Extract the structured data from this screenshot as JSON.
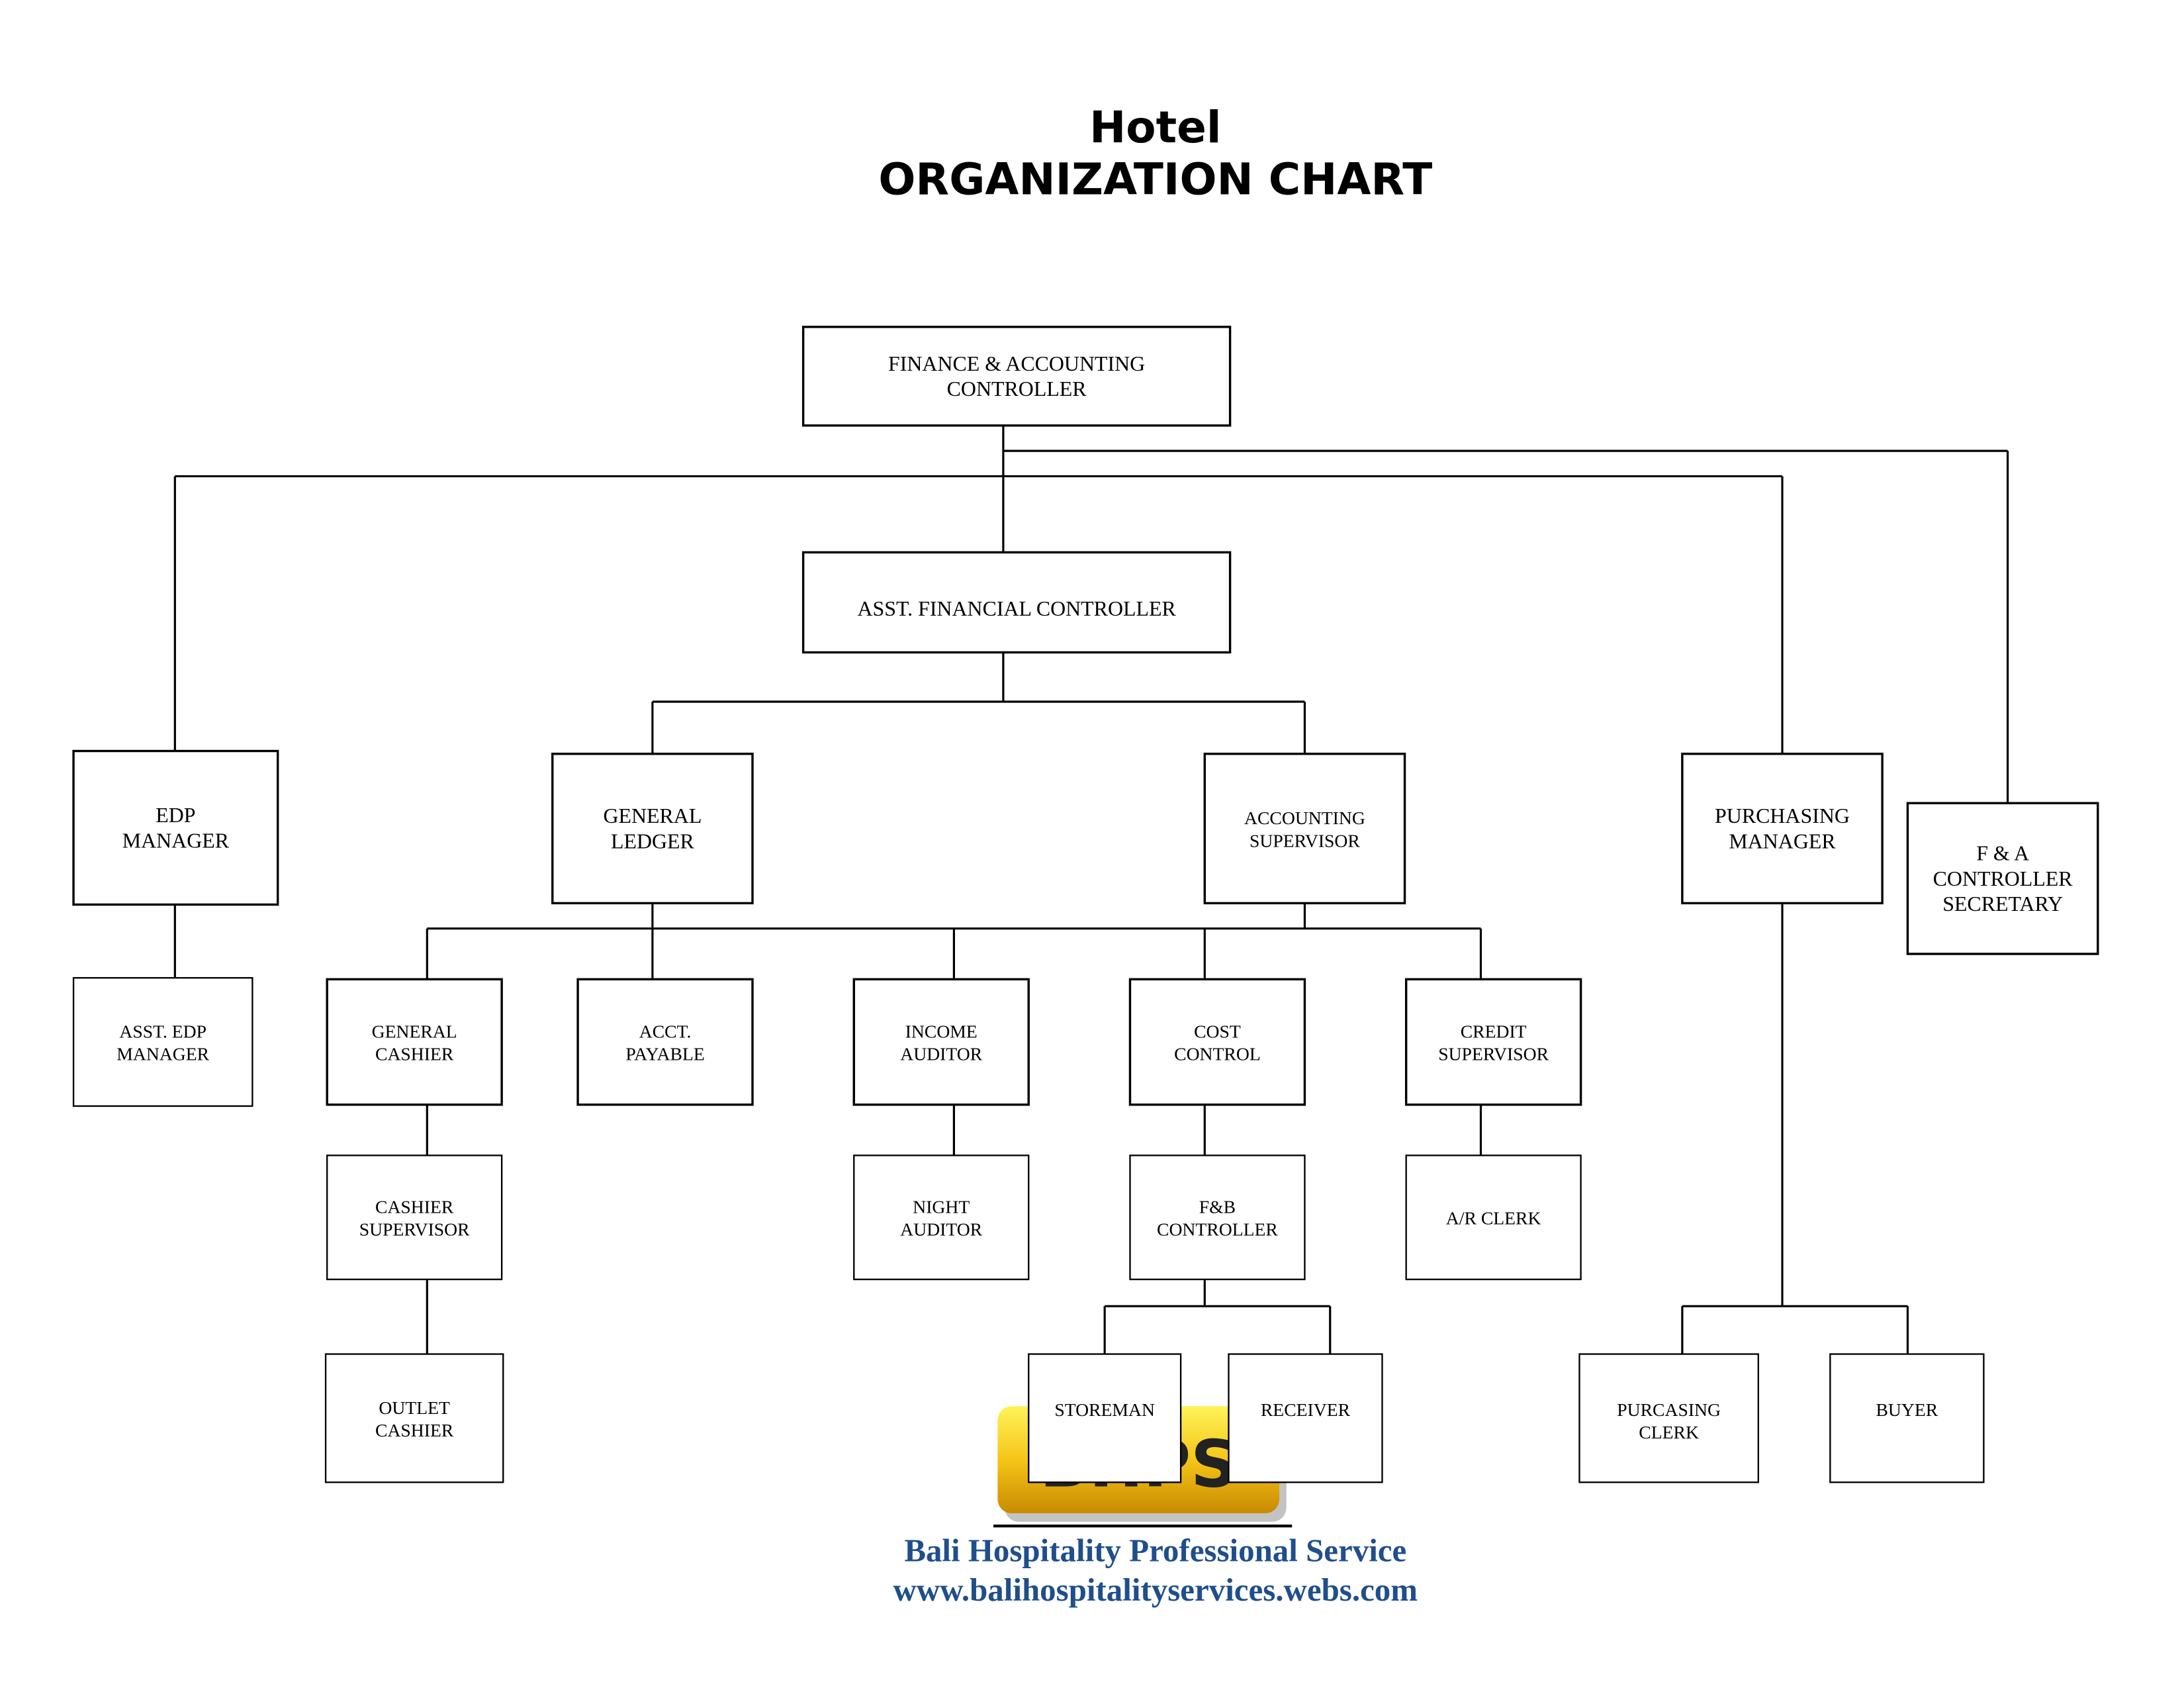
{
  "title": {
    "line1": "Hotel",
    "line2": "ORGANIZATION CHART"
  },
  "positions": {
    "fac": [
      "FINANCE & ACCOUNTING",
      "CONTROLLER"
    ],
    "afc": [
      "ASST. FINANCIAL CONTROLLER"
    ],
    "edp": [
      "EDP",
      "MANAGER"
    ],
    "gl": [
      "GENERAL",
      "LEDGER"
    ],
    "as": [
      "ACCOUNTING",
      "SUPERVISOR"
    ],
    "pm": [
      "PURCHASING",
      "MANAGER"
    ],
    "sec": [
      "F & A",
      "CONTROLLER",
      "SECRETARY"
    ],
    "aedp": [
      "ASST. EDP",
      "MANAGER"
    ],
    "gc": [
      "GENERAL",
      "CASHIER"
    ],
    "ap": [
      "ACCT.",
      "PAYABLE"
    ],
    "ia": [
      "INCOME",
      "AUDITOR"
    ],
    "cc": [
      "COST",
      "CONTROL"
    ],
    "cs": [
      "CREDIT",
      "SUPERVISOR"
    ],
    "csup": [
      "CASHIER",
      "SUPERVISOR"
    ],
    "na": [
      "NIGHT",
      "AUDITOR"
    ],
    "fbc": [
      "F&B",
      "CONTROLLER"
    ],
    "ar": [
      "A/R CLERK"
    ],
    "oc": [
      "OUTLET",
      "CASHIER"
    ],
    "store": [
      "STOREMAN"
    ],
    "recv": [
      "RECEIVER"
    ],
    "pc": [
      "PURCASING",
      "CLERK"
    ],
    "buyer": [
      "BUYER"
    ]
  },
  "footer": {
    "logo_text": "BHPS",
    "company": "Bali Hospitality Professional Service",
    "url": "www.balihospitalityservices.webs.com",
    "brand_color": "#1f4e8c",
    "logo_color": "#f5c518"
  }
}
